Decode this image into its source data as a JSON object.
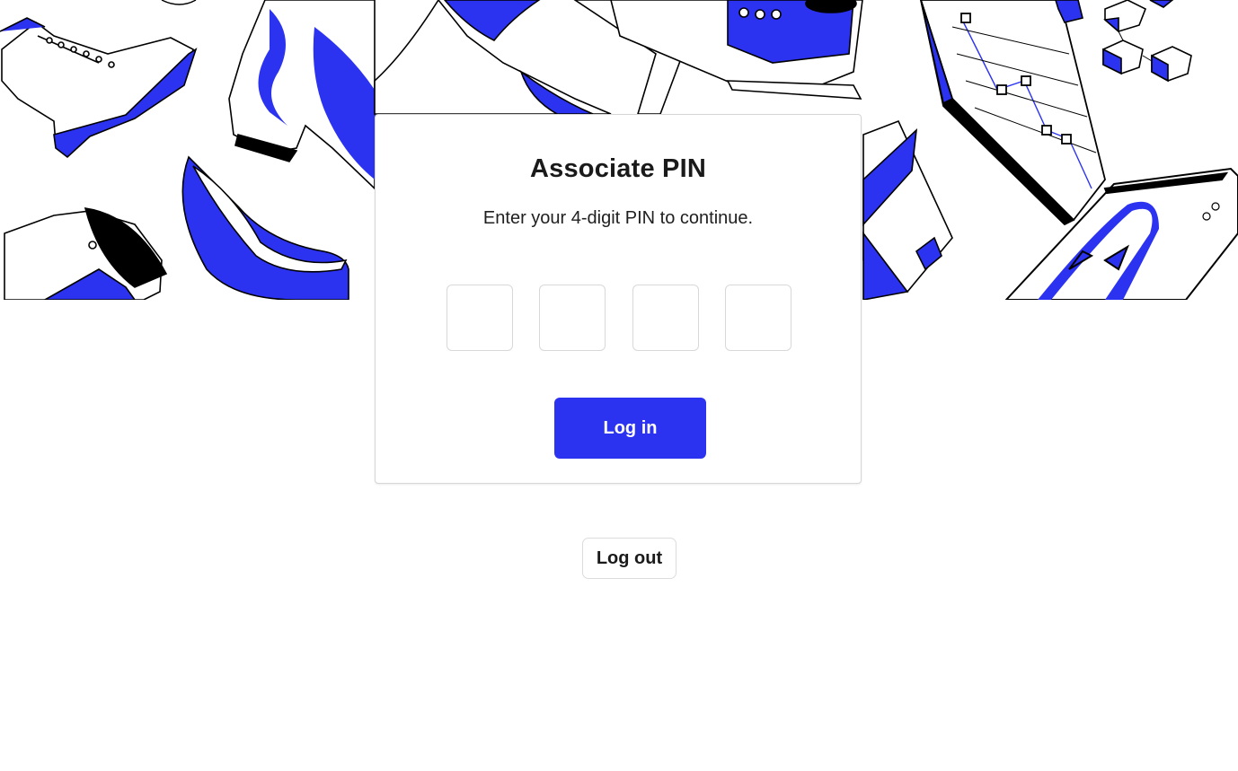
{
  "hero": {
    "illustration": "shoes-packages-phone-laptop-illustration",
    "accent_color": "#2c33f0"
  },
  "card": {
    "title": "Associate PIN",
    "subtitle": "Enter your 4-digit PIN to continue.",
    "pin_digits": [
      {
        "value": "",
        "placeholder": ""
      },
      {
        "value": "",
        "placeholder": ""
      },
      {
        "value": "",
        "placeholder": ""
      },
      {
        "value": "",
        "placeholder": ""
      }
    ],
    "login_label": "Log in",
    "primary_color": "#2c33f0"
  },
  "footer": {
    "logout_label": "Log out"
  }
}
